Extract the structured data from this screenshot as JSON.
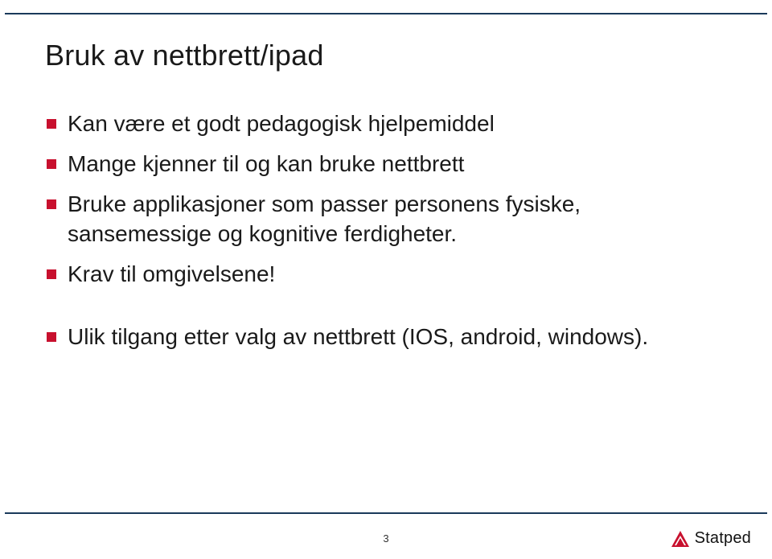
{
  "colors": {
    "accent": "#c8102e",
    "rule": "#1a3a5a"
  },
  "slide": {
    "title": "Bruk av nettbrett/ipad",
    "bullets_main": [
      "Kan være et godt pedagogisk hjelpemiddel",
      "Mange kjenner til og kan bruke nettbrett",
      "Bruke applikasjoner som passer personens fysiske, sansemessige og kognitive ferdigheter.",
      "Krav til omgivelsene!"
    ],
    "bullets_after_gap": [
      "Ulik tilgang etter valg av nettbrett (IOS, android, windows)."
    ],
    "page_number": "3"
  },
  "footer": {
    "brand_name": "Statped",
    "logo_icon": "statped-logo-icon"
  }
}
